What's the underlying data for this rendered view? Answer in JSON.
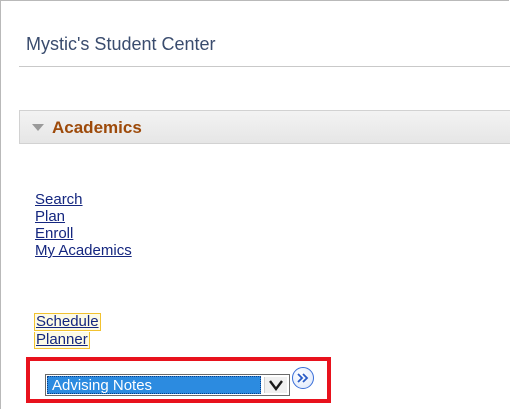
{
  "page": {
    "title": "Mystic's Student Center"
  },
  "section": {
    "label": "Academics",
    "state_icon": "collapse-triangle-icon"
  },
  "links": [
    {
      "label": "Search"
    },
    {
      "label": "Plan"
    },
    {
      "label": "Enroll"
    },
    {
      "label": "My Academics"
    }
  ],
  "planner_links": [
    {
      "label": "Schedule"
    },
    {
      "label": "Planner"
    }
  ],
  "dropdown": {
    "selected": "Advising Notes",
    "icon": "chevron-down-icon"
  },
  "go_button": {
    "icon": "double-chevron-right-icon"
  },
  "colors": {
    "title": "#3a4c6e",
    "section_label": "#9d4a0a",
    "link": "#14267f",
    "highlight_border": "#f2c230",
    "annotation_red": "#e8121d",
    "select_highlight": "#2c8be0"
  }
}
